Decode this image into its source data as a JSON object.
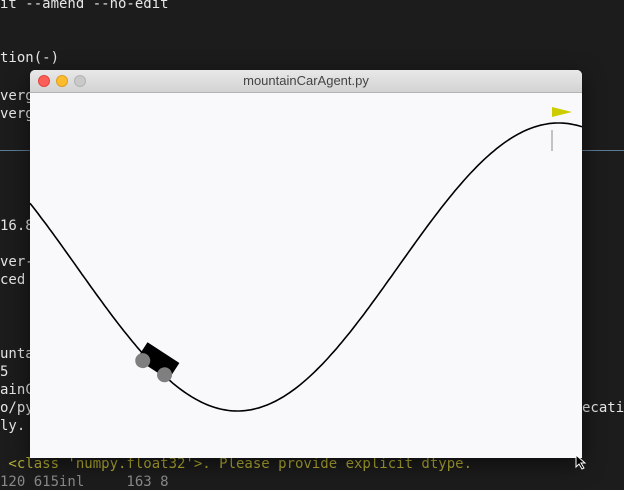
{
  "terminal": {
    "lines": [
      {
        "text": "it --amend --no-edit",
        "style": "normal"
      },
      {
        "text": "tion(-)",
        "style": "normal"
      },
      {
        "text": "verg",
        "style": "normal"
      },
      {
        "text": "verg",
        "style": "normal"
      },
      {
        "text": "16.8",
        "style": "normal"
      },
      {
        "text": "ver-",
        "style": "normal"
      },
      {
        "text": "ced",
        "style": "normal"
      },
      {
        "text": "unta",
        "style": "normal"
      },
      {
        "text": "5",
        "style": "normal"
      },
      {
        "text": "ainC",
        "style": "normal"
      },
      {
        "text": "o/py",
        "style": "normal"
      },
      {
        "text": "ly.",
        "style": "normal"
      },
      {
        "text": "ecati",
        "style": "normal"
      },
      {
        "text": " <class 'numpy.float32'>. Please provide explicit dtype.",
        "style": "warn"
      },
      {
        "text": "120 615inl     163 8",
        "style": "dim"
      }
    ]
  },
  "window": {
    "title": "mountainCarAgent.py",
    "buttons": {
      "close": "close",
      "minimize": "minimize",
      "zoom": "zoom"
    }
  },
  "scene": {
    "track_color": "#000000",
    "flag_color": "#cccc00",
    "car_color": "#000000",
    "wheel_color": "#7f7f7f",
    "flagpole_color": "#8a8a8a"
  },
  "icons": {
    "resize_cursor": "resize-cursor-icon"
  }
}
